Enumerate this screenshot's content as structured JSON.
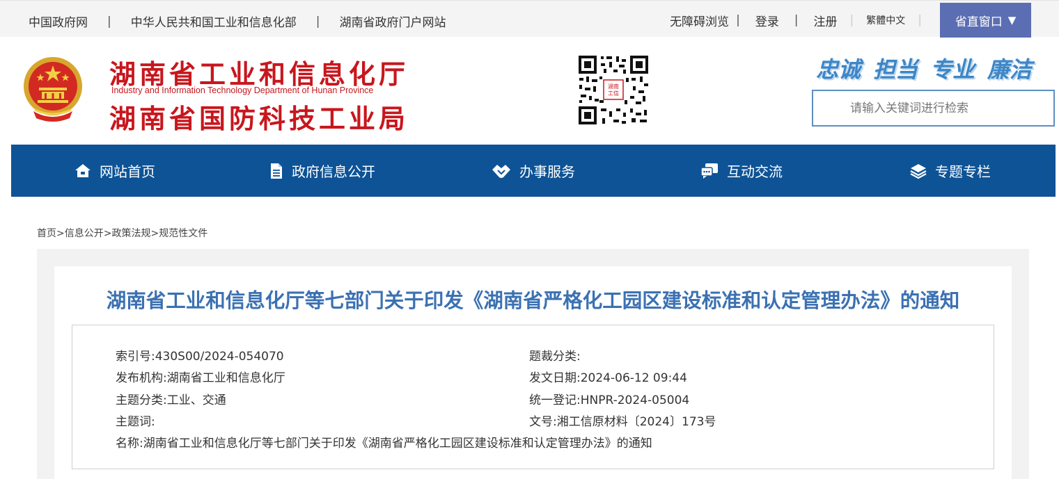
{
  "topbar": {
    "links": [
      "中国政府网",
      "中华人民共和国工业和信息化部",
      "湖南省政府门户网站"
    ],
    "separator": "|",
    "accessibility": "无障碍浏览",
    "login": "登录",
    "register": "注册",
    "lang": "繁體中文",
    "province_window": "省直窗口",
    "province_window_arrow": "▼"
  },
  "header": {
    "title_cn_1": "湖南省工业和信息化厅",
    "title_en": "Industry and Information Technology Department of Hunan Province",
    "title_cn_2": "湖南省国防科技工业局",
    "qr_label": "湖南工信",
    "slogans": [
      "忠诚",
      "担当",
      "专业",
      "廉洁"
    ],
    "search_placeholder": "请输入关键词进行检索"
  },
  "nav": {
    "items": [
      {
        "label": "网站首页",
        "icon": "home-icon"
      },
      {
        "label": "政府信息公开",
        "icon": "document-icon"
      },
      {
        "label": "办事服务",
        "icon": "handshake-icon"
      },
      {
        "label": "互动交流",
        "icon": "chat-icon"
      },
      {
        "label": "专题专栏",
        "icon": "layers-icon"
      }
    ]
  },
  "breadcrumb": {
    "text": "首页>信息公开>政策法规>规范性文件"
  },
  "document": {
    "title": "湖南省工业和信息化厅等七部门关于印发《湖南省严格化工园区建设标准和认定管理办法》的通知",
    "meta": {
      "index_no_label": "索引号:",
      "index_no": "430S00/2024-054070",
      "category_label": "题裁分类:",
      "category": "",
      "publisher_label": "发布机构:",
      "publisher": "湖南省工业和信息化厅",
      "date_label": "发文日期:",
      "date": "2024-06-12 09:44",
      "topic_label": "主题分类:",
      "topic": "工业、交通",
      "reg_label": "统一登记:",
      "reg": "HNPR-2024-05004",
      "keywords_label": "主题词:",
      "keywords": "",
      "doc_no_label": "文号:",
      "doc_no": "湘工信原材料〔2024〕173号",
      "name_label": "名称:",
      "name": "湖南省工业和信息化厅等七部门关于印发《湖南省严格化工园区建设标准和认定管理办法》的通知"
    }
  },
  "colors": {
    "brand_red": "#c8161d",
    "nav_blue": "#0e5396",
    "province_button": "#5b6eb4",
    "title_blue": "#3b71b2",
    "slogan_blue": "#3d86c7"
  }
}
